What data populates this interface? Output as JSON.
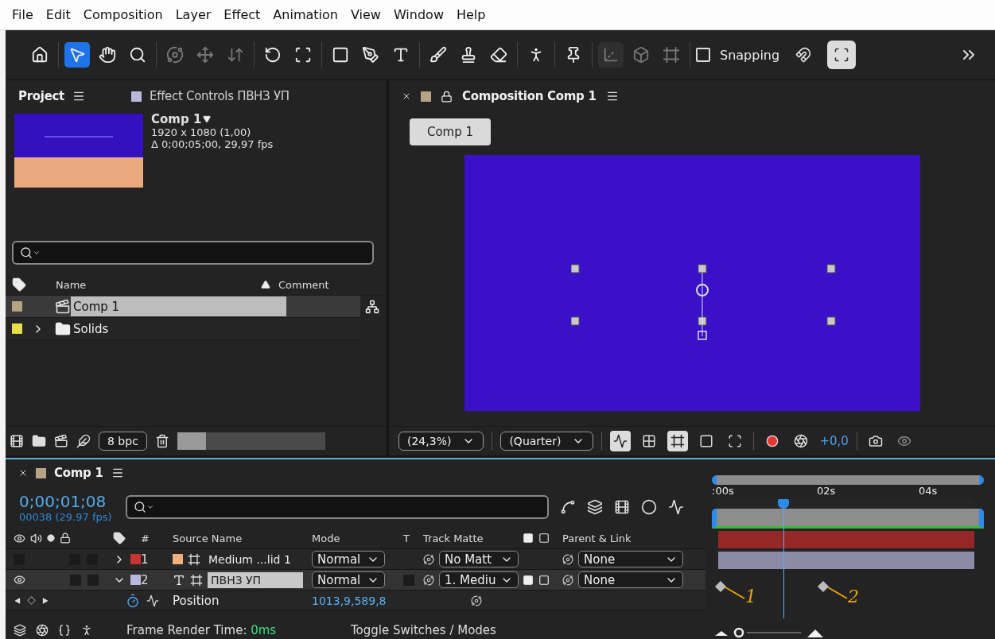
{
  "menu": [
    "File",
    "Edit",
    "Composition",
    "Layer",
    "Effect",
    "Animation",
    "View",
    "Window",
    "Help"
  ],
  "toolbar": {
    "tool_groups": [
      {
        "tools": [
          {
            "selected": false,
            "disabled": false
          }
        ]
      },
      {
        "tools": [
          {
            "selected": true,
            "disabled": false
          },
          {
            "selected": false,
            "disabled": false
          },
          {
            "selected": false,
            "disabled": false
          }
        ]
      },
      {
        "tools": [
          {
            "selected": false,
            "disabled": true
          },
          {
            "selected": false,
            "disabled": true
          },
          {
            "selected": false,
            "disabled": true
          }
        ]
      },
      {
        "tools": [
          {
            "selected": false,
            "disabled": false
          },
          {
            "selected": false,
            "disabled": false
          }
        ]
      },
      {
        "tools": [
          {
            "selected": false,
            "disabled": false
          },
          {
            "selected": false,
            "disabled": false
          },
          {
            "selected": false,
            "disabled": false
          }
        ]
      },
      {
        "tools": [
          {
            "selected": false,
            "disabled": false
          },
          {
            "selected": false,
            "disabled": false
          },
          {
            "selected": false,
            "disabled": false
          }
        ]
      },
      {
        "tools": [
          {
            "selected": false,
            "disabled": false
          }
        ]
      },
      {
        "tools": [
          {
            "selected": false,
            "disabled": false
          }
        ]
      },
      {
        "tools": [
          {
            "selected": true,
            "disabled": true
          },
          {
            "selected": false,
            "disabled": true
          },
          {
            "selected": false,
            "disabled": true
          }
        ]
      }
    ],
    "snapping": {
      "label": "Snapping",
      "checked": false
    },
    "snap_tools": [
      {
        "selected": false
      },
      {
        "selected": true
      }
    ]
  },
  "project": {
    "tabs": [
      {
        "label": "Project",
        "selected": true
      },
      {
        "label": "Effect Controls ПВНЗ УП",
        "selected": false,
        "color": "#b9b9dd"
      }
    ],
    "info": {
      "name": "Comp 1",
      "size": "1920 x 1080 (1,00)",
      "duration": "Δ 0;00;05;00, 29,97 fps"
    },
    "columns": [
      "Name",
      "Comment"
    ],
    "items": [
      {
        "kind": "comp",
        "name": "Comp 1",
        "color": "#b5a384",
        "selected": true
      },
      {
        "kind": "folder",
        "name": "Solids",
        "color": "#e6dd4a",
        "selected": false,
        "expanded": false
      }
    ],
    "bit_depth": "8 bpc"
  },
  "composition": {
    "tab": "Composition Comp 1",
    "color": "#b5a384",
    "breadcrumb": "Comp 1",
    "zoom": "(24,3%)",
    "resolution": "(Quarter)",
    "exposure": "+0,0"
  },
  "timeline": {
    "tab": "Comp 1",
    "color": "#b5a384",
    "timecode": "0;00;01;08",
    "frame": "00038 (29.97 fps)",
    "columns": {
      "number": "#",
      "source": "Source Name",
      "mode": "Mode",
      "t": "T",
      "matte": "Track Matte",
      "parent": "Parent & Link"
    },
    "ruler": [
      ":00s",
      "02s",
      "04s"
    ],
    "playhead": {
      "level": 0.26
    },
    "layers": [
      {
        "kind": "solid",
        "number": "1",
        "name": "Medium ...lid 1",
        "color": "#c83434",
        "mode": "Normal",
        "matte": "No Matt",
        "parent": "None",
        "visible": false,
        "expanded": false,
        "selected": false
      },
      {
        "kind": "text",
        "number": "2",
        "name": "ПВНЗ УП",
        "color": "#b9b9dd",
        "mode": "Normal",
        "matte": "1. Mediu",
        "parent": "None",
        "visible": true,
        "expanded": true,
        "selected": true
      }
    ],
    "property": {
      "name": "Position",
      "value": "1013,9,589,8"
    },
    "keyframes": [
      {
        "annotation": "1"
      },
      {
        "annotation": "2"
      }
    ],
    "footer": {
      "label": "Frame Render Time: ",
      "time": "0ms",
      "toggle": "Toggle Switches / Modes"
    }
  }
}
